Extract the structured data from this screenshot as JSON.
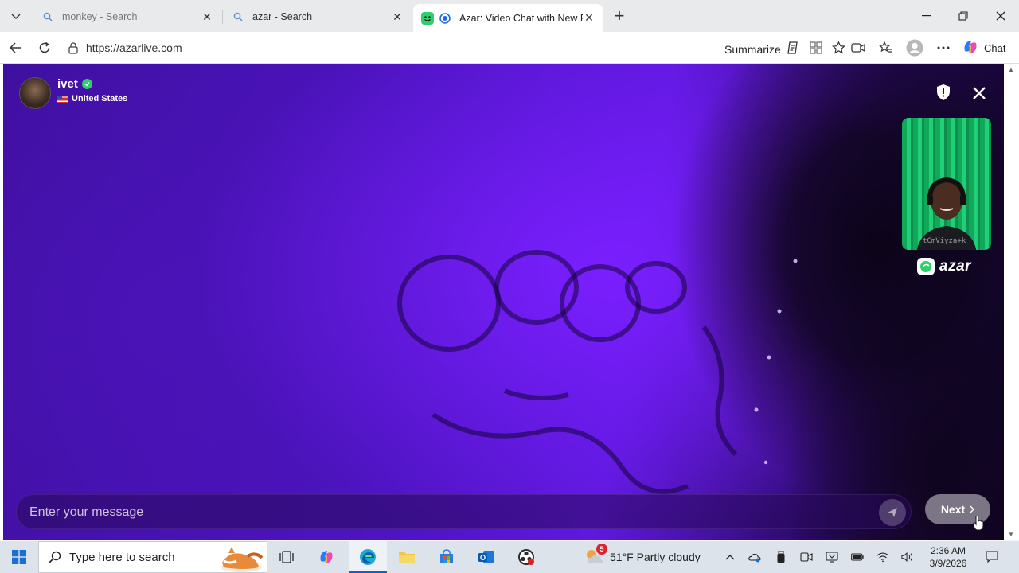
{
  "browser": {
    "tabs": [
      {
        "title": "monkey - Search",
        "active": false
      },
      {
        "title": "azar - Search",
        "active": false
      },
      {
        "title": "Azar: Video Chat with New People",
        "active": true
      }
    ],
    "url": "https://azarlive.com",
    "summarize_label": "Summarize",
    "chat_label": "Chat"
  },
  "chat": {
    "partner_name": "ivet",
    "partner_country": "United States",
    "self_watermark": "tCmViyza+k",
    "brand_name": "azar",
    "message_placeholder": "Enter your message",
    "next_label": "Next"
  },
  "taskbar": {
    "search_placeholder": "Type here to search",
    "weather_badge": "5",
    "weather_text": "51°F  Partly cloudy",
    "time": "2:36 AM",
    "date": "3/9/2026"
  },
  "colors": {
    "accent": "#2ecf6b",
    "video_purple": "#5d18dc"
  }
}
